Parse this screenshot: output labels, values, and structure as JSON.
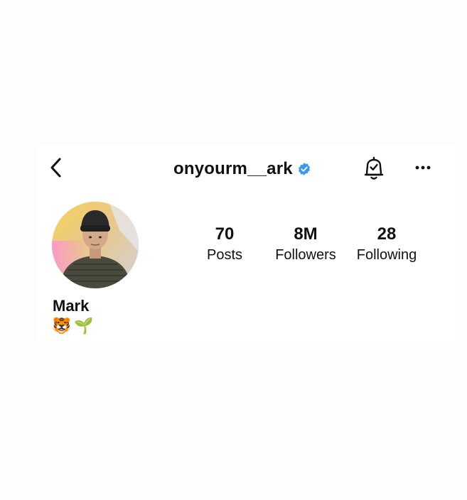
{
  "header": {
    "username": "onyourm__ark",
    "verified": true,
    "back_icon": "chevron-left-icon",
    "bell_icon": "notification-bell-icon",
    "more_icon": "more-horizontal-icon",
    "verified_color": "#3897f0"
  },
  "stats": [
    {
      "value": "70",
      "label": "Posts"
    },
    {
      "value": "8M",
      "label": "Followers"
    },
    {
      "value": "28",
      "label": "Following"
    }
  ],
  "profile": {
    "name": "Mark",
    "bio": "🐯🌱"
  }
}
